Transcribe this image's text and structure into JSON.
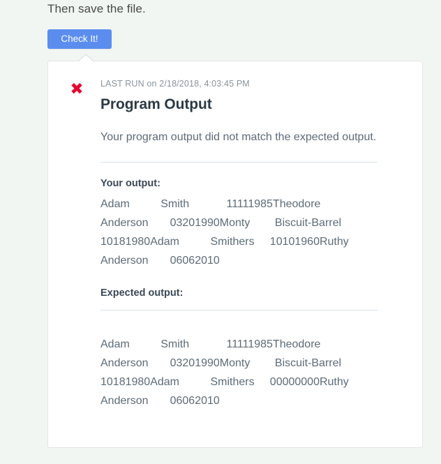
{
  "page": {
    "background_color": "#f1f6f2",
    "instruction": "Then save the file."
  },
  "check_button": {
    "label": "Check It!",
    "color": "#5b8def"
  },
  "result_card": {
    "status_icon": "cross-mark-icon",
    "status_icon_glyph": "✖",
    "status_color": "#e4092e",
    "last_run": "LAST RUN on 2/18/2018, 4:03:45 PM",
    "title": "Program Output",
    "message": "Your program output did not match the expected output.",
    "your_output_label": "Your output:",
    "your_output": "Adam          Smith            11111985Theodore       Anderson       03201990Monty        Biscuit-Barrel  10181980Adam          Smithers     10101960Ruthy        Anderson       06062010",
    "expected_output_label": "Expected output:",
    "expected_output": "Adam          Smith            11111985Theodore       Anderson       03201990Monty        Biscuit-Barrel  10181980Adam          Smithers     00000000Ruthy        Anderson       06062010"
  }
}
